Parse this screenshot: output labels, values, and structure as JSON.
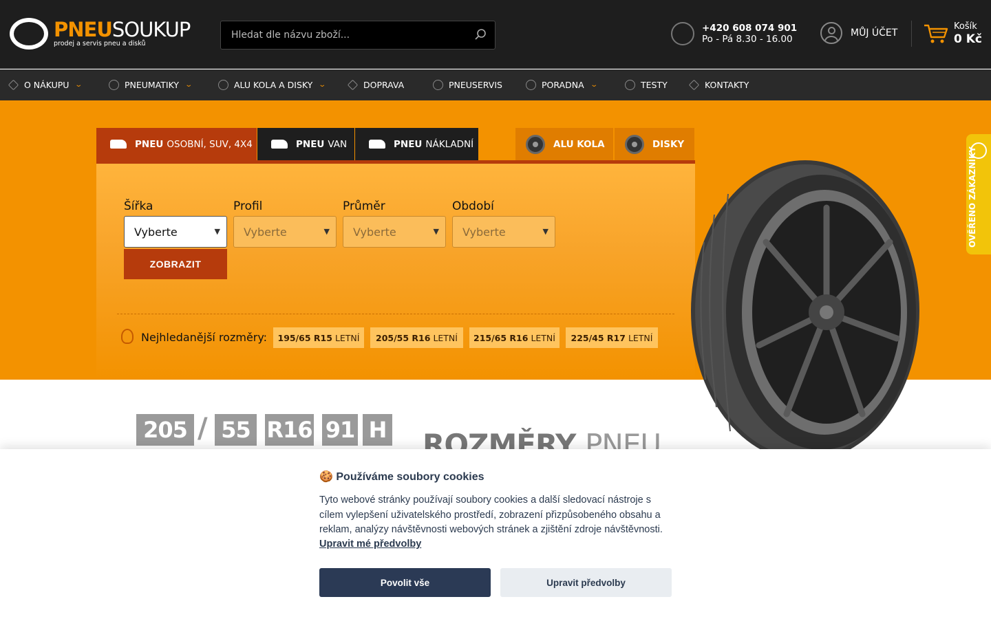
{
  "header": {
    "logo_part1": "PNEU",
    "logo_part2": "SOUKUP",
    "logo_tagline": "prodej a servis pneu a disků",
    "search_placeholder": "Hledat dle názvu zboží...",
    "phone_number": "+420 608 074 901",
    "phone_hours": "Po - Pá 8.30 - 16.00",
    "account_label": "MŮJ ÚČET",
    "cart_label": "Košík",
    "cart_value": "0 Kč"
  },
  "nav": {
    "items": [
      {
        "label": "O NÁKUPU"
      },
      {
        "label": "PNEUMATIKY"
      },
      {
        "label": "ALU KOLA A DISKY"
      },
      {
        "label": "DOPRAVA"
      },
      {
        "label": "PNEUSERVIS"
      },
      {
        "label": "PORADNA"
      },
      {
        "label": "TESTY"
      },
      {
        "label": "KONTAKTY"
      }
    ]
  },
  "tabs": [
    {
      "bold": "PNEU",
      "rest": "OSOBNÍ, SUV, 4X4"
    },
    {
      "bold": "PNEU",
      "rest": "VAN"
    },
    {
      "bold": "PNEU",
      "rest": "NÁKLADNÍ"
    },
    {
      "label": "ALU KOLA"
    },
    {
      "label": "DISKY"
    }
  ],
  "filter": {
    "fields": [
      {
        "label": "Šířka",
        "value": "Vyberte"
      },
      {
        "label": "Profil",
        "value": "Vyberte"
      },
      {
        "label": "Průměr",
        "value": "Vyberte"
      },
      {
        "label": "Období",
        "value": "Vyberte"
      }
    ],
    "submit_label": "ZOBRAZIT",
    "popular_label": "Nejhledanější rozměry:",
    "popular": [
      {
        "size": "195/65 R15",
        "season": "LETNÍ"
      },
      {
        "size": "205/55 R16",
        "season": "LETNÍ"
      },
      {
        "size": "215/65 R16",
        "season": "LETNÍ"
      },
      {
        "size": "225/45 R17",
        "season": "LETNÍ"
      }
    ]
  },
  "reviews_label": "OVĚŘENO ZÁKAZNÍKY",
  "size_demo": {
    "parts": [
      "205",
      "55",
      "R16",
      "91",
      "H"
    ],
    "slash": "/",
    "heading_bold": "ROZMĚRY",
    "heading_light": "PNEU"
  },
  "cookie": {
    "title": "🍪 Používáme soubory cookies",
    "text": "Tyto webové stránky používají soubory cookies a další sledovací nástroje s cílem vylepšení uživatelského prostředí, zobrazení přizpůsobeného obsahu a reklam, analýzy návštěvnosti webových stránek a zjištění zdroje návštěvnosti.",
    "link": "Upravit mé předvolby",
    "accept_label": "Povolit vše",
    "prefs_label": "Upravit předvolby"
  },
  "colors": {
    "brand_orange": "#f39200",
    "brand_dark_red": "#b63b0c",
    "header_bg": "#1e1e1e",
    "cookie_button": "#2b3a55"
  }
}
